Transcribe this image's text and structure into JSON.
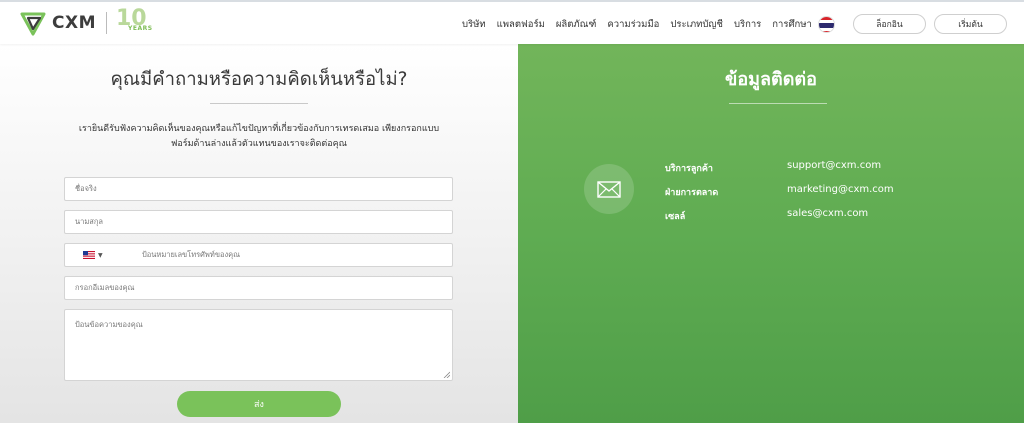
{
  "brand": {
    "name": "CXM",
    "years_number": "10",
    "years_label": "YEARS",
    "accent": "#7ac25a"
  },
  "nav": {
    "items": [
      {
        "label": "บริษัท"
      },
      {
        "label": "แพลตฟอร์ม"
      },
      {
        "label": "ผลิตภัณฑ์"
      },
      {
        "label": "ความร่วมมือ"
      },
      {
        "label": "ประเภทบัญชี"
      },
      {
        "label": "บริการ"
      },
      {
        "label": "การศึกษา"
      }
    ],
    "login_label": "ล็อกอิน",
    "start_label": "เริ่มต้น",
    "language_flag_icon": "thailand-flag-icon"
  },
  "form": {
    "title": "คุณมีคำถามหรือความคิดเห็นหรือไม่?",
    "description_line1": "เรายินดีรับฟังความคิดเห็นของคุณหรือแก้ไขปัญหาที่เกี่ยวข้องกับการเทรดเสมอ เพียงกรอกแบบ",
    "description_line2": "ฟอร์มด้านล่างแล้วตัวแทนของเราจะติดต่อคุณ",
    "first_name_placeholder": "ชื่อจริง",
    "last_name_placeholder": "นามสกุล",
    "phone_country_icon": "us-flag-icon",
    "phone_placeholder": "ป้อนหมายเลขโทรศัพท์ของคุณ",
    "email_placeholder": "กรอกอีเมลของคุณ",
    "message_placeholder": "ป้อนข้อความของคุณ",
    "submit_label": "ส่ง"
  },
  "contact": {
    "title": "ข้อมูลติดต่อ",
    "icon": "envelope-icon",
    "rows": [
      {
        "label": "บริการลูกค้า",
        "value": "support@cxm.com"
      },
      {
        "label": "ฝ่ายการตลาด",
        "value": "marketing@cxm.com"
      },
      {
        "label": "เซลล์",
        "value": "sales@cxm.com"
      }
    ]
  }
}
